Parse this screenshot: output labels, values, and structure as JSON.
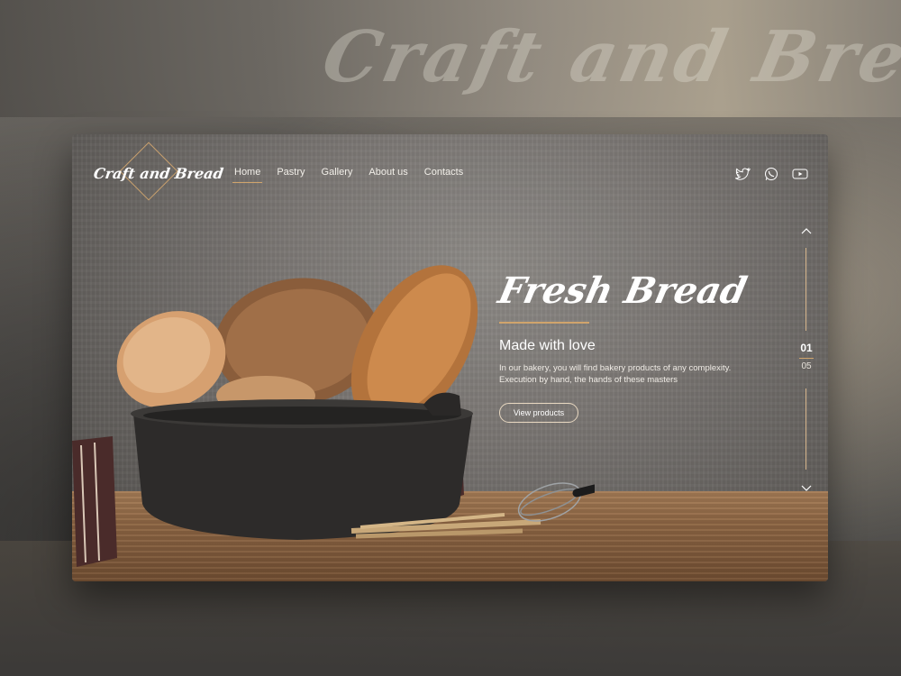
{
  "background_title": "Craft and Bread",
  "logo": {
    "text": "Craft and Bread"
  },
  "nav": {
    "items": [
      {
        "label": "Home",
        "active": true
      },
      {
        "label": "Pastry",
        "active": false
      },
      {
        "label": "Gallery",
        "active": false
      },
      {
        "label": "About us",
        "active": false
      },
      {
        "label": "Contacts",
        "active": false
      }
    ]
  },
  "social": [
    "twitter-icon",
    "whatsapp-icon",
    "youtube-icon"
  ],
  "hero": {
    "title": "Fresh Bread",
    "subtitle": "Made with love",
    "description_line1": "In our bakery, you will find bakery products of any complexity.",
    "description_line2": "Execution by hand, the hands of these masters",
    "button_label": "View products"
  },
  "pager": {
    "current": "01",
    "total": "05"
  },
  "colors": {
    "accent": "#d0a46c",
    "text": "#ffffff"
  }
}
